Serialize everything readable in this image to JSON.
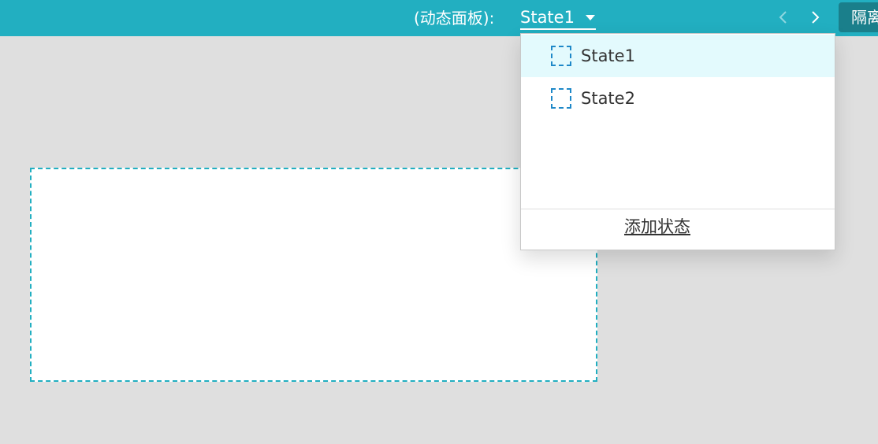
{
  "toolbar": {
    "panel_label": "(动态面板):",
    "current_state": "State1",
    "isolate_label": "隔离"
  },
  "dropdown": {
    "items": [
      {
        "label": "State1",
        "icon": "dashed-square-icon",
        "selected": true
      },
      {
        "label": "State2",
        "icon": "dashed-square-icon",
        "selected": false
      }
    ],
    "add_state_label": "添加状态"
  },
  "colors": {
    "toolbar_bg": "#22afc1",
    "selected_item_bg": "#e3fafd",
    "state_icon_border": "#1e88c8",
    "canvas_border": "#22afc1",
    "isolate_button_bg": "#1a7f8b"
  }
}
